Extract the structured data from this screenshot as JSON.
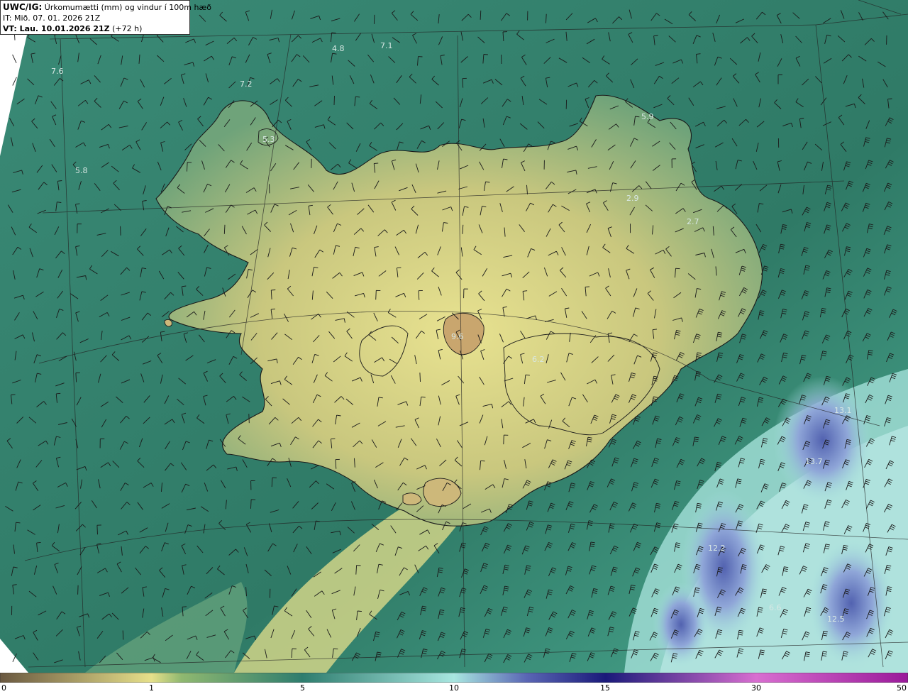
{
  "header": {
    "model": "UWC/IG:",
    "title": "Úrkomumætti (mm) og vindur í 100m hæð",
    "init_time": "IT: Mið. 07. 01. 2026 21Z",
    "valid_prefix": "VT: Lau. 10.01.2026 21Z",
    "valid_suffix": "(+72 h)"
  },
  "legend": {
    "ticks": [
      "0",
      "1",
      "5",
      "10",
      "15",
      "30",
      "50"
    ],
    "colors": [
      "#6a5840",
      "#a89458",
      "#e6e08a",
      "#2e7d6e",
      "#a8e6e0",
      "#5a66b4",
      "#1a1a7a",
      "#d86ed0",
      "#9a1a9a"
    ]
  },
  "map_labels": [
    "4.8",
    "7.1",
    "7.6",
    "7.2",
    "5.9",
    "5.3",
    "2.9",
    "2.7",
    "9.6",
    "6.2",
    "13.1",
    "13.7",
    "12.2",
    "6.6",
    "12.5",
    "5.8"
  ],
  "colors": {
    "sea": "#3f8a78",
    "land_high": "#e2dc8c",
    "land_mid": "#a9b872",
    "heavy_precip": "#5c6ab8",
    "light_precip": "#9fdcd4"
  }
}
